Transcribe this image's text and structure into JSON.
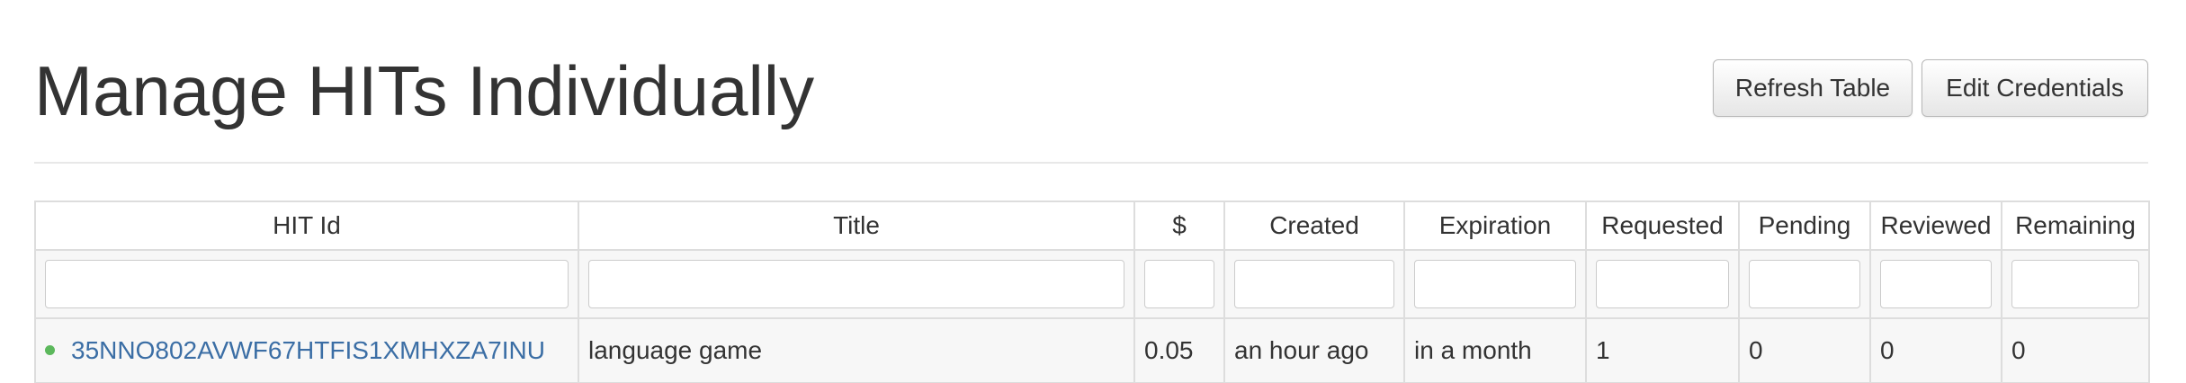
{
  "header": {
    "title": "Manage HITs Individually",
    "refresh_label": "Refresh Table",
    "credentials_label": "Edit Credentials"
  },
  "table": {
    "columns": [
      "HIT Id",
      "Title",
      "$",
      "Created",
      "Expiration",
      "Requested",
      "Pending",
      "Reviewed",
      "Remaining"
    ],
    "filters": [
      "",
      "",
      "",
      "",
      "",
      "",
      "",
      "",
      ""
    ],
    "rows": [
      {
        "status_color": "#5cb85c",
        "hit_id": "35NNO802AVWF67HTFIS1XMHXZA7INU",
        "title": "language game",
        "reward": "0.05",
        "created": "an hour ago",
        "expiration": "in a month",
        "requested": "1",
        "pending": "0",
        "reviewed": "0",
        "remaining": "0"
      }
    ]
  }
}
